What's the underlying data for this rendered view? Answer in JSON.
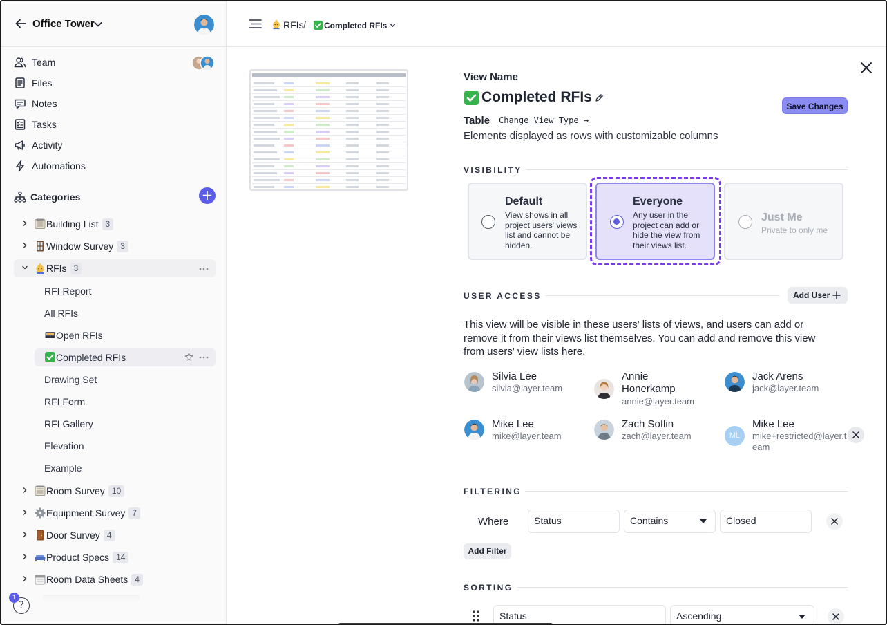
{
  "sidebar": {
    "project_title": "Office Tower",
    "nav": [
      {
        "label": "Team",
        "icon": "team-icon"
      },
      {
        "label": "Files",
        "icon": "files-icon"
      },
      {
        "label": "Notes",
        "icon": "notes-icon"
      },
      {
        "label": "Tasks",
        "icon": "tasks-icon"
      },
      {
        "label": "Activity",
        "icon": "activity-icon"
      },
      {
        "label": "Automations",
        "icon": "automations-icon"
      }
    ],
    "categories_label": "Categories",
    "categories": [
      {
        "label": "Building List",
        "count": "3",
        "icon": "building-list-icon"
      },
      {
        "label": "Window Survey",
        "count": "3",
        "icon": "window-icon"
      },
      {
        "label": "RFIs",
        "count": "3",
        "icon": "rfi-icon"
      },
      {
        "label": "Room Survey",
        "count": "10",
        "icon": "room-icon"
      },
      {
        "label": "Equipment Survey",
        "count": "7",
        "icon": "gear-icon"
      },
      {
        "label": "Door Survey",
        "count": "4",
        "icon": "door-icon"
      },
      {
        "label": "Product Specs",
        "count": "14",
        "icon": "sofa-icon"
      },
      {
        "label": "Room Data Sheets",
        "count": "4",
        "icon": "calendar-icon"
      }
    ],
    "rfi_views": [
      {
        "label": "RFI Report"
      },
      {
        "label": "All RFIs"
      },
      {
        "label": "Open RFIs",
        "icon": "inbox-icon"
      },
      {
        "label": "Completed RFIs",
        "icon": "check-icon"
      },
      {
        "label": "Drawing Set"
      },
      {
        "label": "RFI Form"
      },
      {
        "label": "RFI Gallery"
      },
      {
        "label": "Elevation"
      },
      {
        "label": "Example"
      }
    ],
    "help_label": "?",
    "help_count": "1"
  },
  "topbar": {
    "breadcrumb_root": "RFIs",
    "breadcrumb_separator": "/",
    "breadcrumb_current": "Completed RFIs"
  },
  "view": {
    "name_label": "View Name",
    "title": "Completed RFIs",
    "save_label": "Save Changes",
    "type_label": "Table",
    "change_type_label": "Change View Type →",
    "type_description": "Elements displayed as rows with customizable columns"
  },
  "visibility": {
    "section_title": "VISIBILITY",
    "options": [
      {
        "title": "Default",
        "description": "View shows in all project users' views list and cannot be hidden."
      },
      {
        "title": "Everyone",
        "description": "Any user in the project can add or hide the view from their views list."
      },
      {
        "title": "Just Me",
        "description": "Private to only me"
      }
    ],
    "selected": "Everyone"
  },
  "user_access": {
    "section_title": "USER ACCESS",
    "add_user_label": "Add User",
    "description": "This view will be visible in these users' lists of views, and users can add or remove it from their views list themselves. You can add and remove this view from users' view lists here.",
    "users": [
      {
        "name": "Silvia Lee",
        "email": "silvia@layer.team"
      },
      {
        "name": "Annie Honerkamp",
        "email": "annie@layer.team"
      },
      {
        "name": "Jack Arens",
        "email": "jack@layer.team"
      },
      {
        "name": "Mike Lee",
        "email": "mike@layer.team"
      },
      {
        "name": "Zach Soflin",
        "email": "zach@layer.team"
      },
      {
        "name": "Mike Lee",
        "email": "mike+restricted@layer.team",
        "initials": "ML"
      }
    ]
  },
  "filtering": {
    "section_title": "FILTERING",
    "where_label": "Where",
    "field": "Status",
    "operator": "Contains",
    "value": "Closed",
    "add_filter_label": "Add Filter"
  },
  "sorting": {
    "section_title": "SORTING",
    "field": "Status",
    "direction": "Ascending"
  },
  "colors": {
    "accent": "#5b5ce8",
    "selected_card_bg": "#e5e1fb",
    "focus_ring": "#7c3aed",
    "save_button": "#8b8cf2"
  }
}
